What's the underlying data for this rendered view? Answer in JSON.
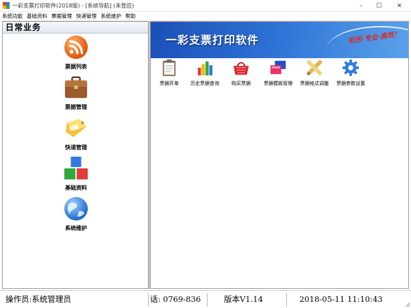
{
  "window": {
    "title": "一彩支票打印软件(2018版) - [系统导航] (未登应)",
    "controls": {
      "minimize": "–",
      "maximize": "☐",
      "close": "✕"
    }
  },
  "menu": [
    "系统功能",
    "基础资料",
    "票据管理",
    "快递管理",
    "系统维护",
    "帮助"
  ],
  "left_panel": {
    "header": "日常业务",
    "items": [
      {
        "label": "票据列表",
        "icon": "rss-icon"
      },
      {
        "label": "票据管理",
        "icon": "briefcase-icon"
      },
      {
        "label": "快递管理",
        "icon": "package-tag-icon"
      },
      {
        "label": "基础资料",
        "icon": "blocks-icon"
      },
      {
        "label": "系统维护",
        "icon": "globe-icon"
      }
    ]
  },
  "banner": {
    "title": "一彩支票打印软件",
    "slogan": "彩形·专业·高效！"
  },
  "toolbar": [
    {
      "label": "票据开单",
      "icon": "clipboard-icon"
    },
    {
      "label": "历史票据查询",
      "icon": "bar-chart-icon"
    },
    {
      "label": "购买票据",
      "icon": "basket-icon"
    },
    {
      "label": "票据模板管理",
      "icon": "templates-icon"
    },
    {
      "label": "票据格式调整",
      "icon": "ruler-pencil-icon"
    },
    {
      "label": "票据参数设置",
      "icon": "gear-icon"
    }
  ],
  "status": {
    "operator": "操作员:系统管理员",
    "phone": "话: 0769-836",
    "version": "版本V1.14",
    "datetime": "2018-05-11  11:10:43"
  },
  "colors": {
    "banner_dark": "#1c4fb8",
    "banner_light": "#5aa2ea",
    "slogan": "#d62c2c"
  }
}
